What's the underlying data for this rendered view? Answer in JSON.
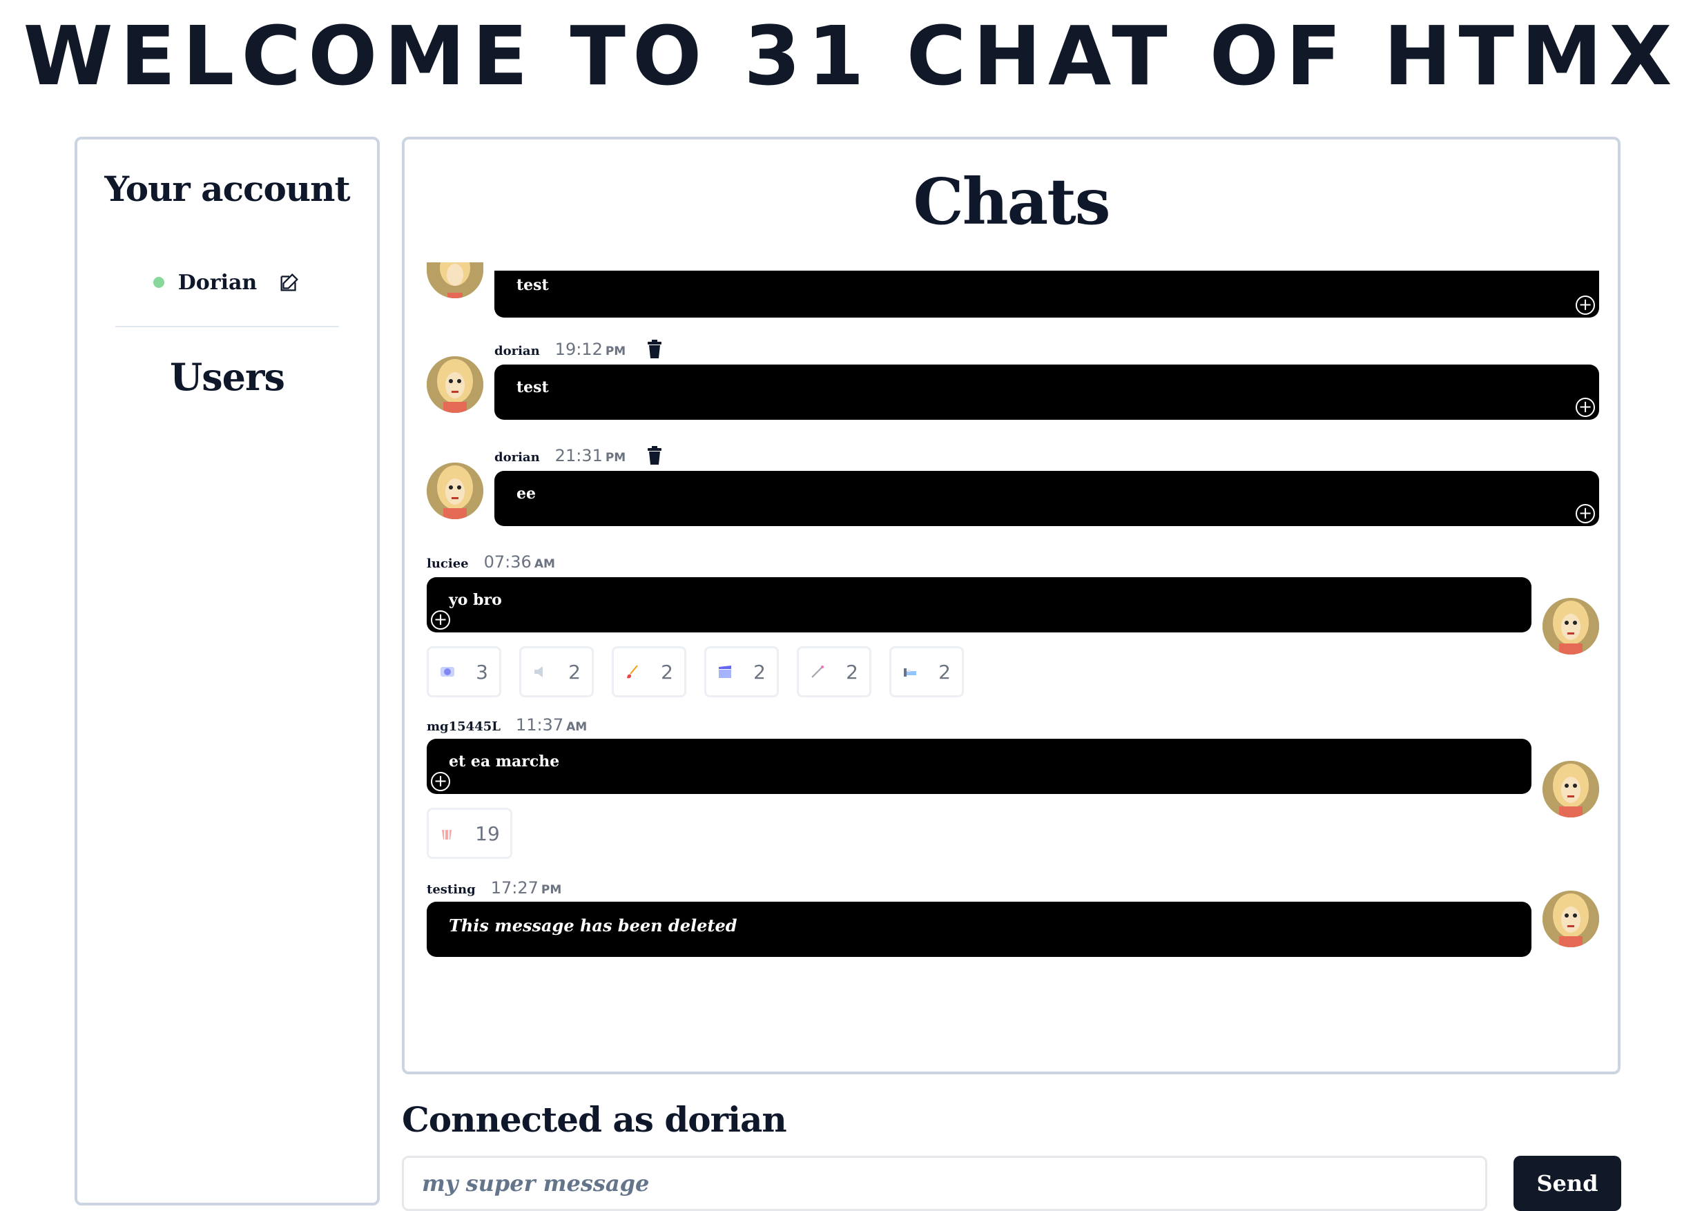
{
  "page_title": "WELCOME TO 31 CHAT OF HTMX",
  "account": {
    "heading": "Your account",
    "username": "Dorian",
    "users_heading": "Users"
  },
  "chats": {
    "heading": "Chats",
    "messages": [
      {
        "text": "test"
      },
      {
        "author": "dorian",
        "time": "19:12",
        "ampm": "PM",
        "text": "test"
      },
      {
        "author": "dorian",
        "time": "21:31",
        "ampm": "PM",
        "text": "ee"
      },
      {
        "author": "luciee",
        "time": "07:36",
        "ampm": "AM",
        "text": "yo bro"
      },
      {
        "author": "mg15445L",
        "time": "11:37",
        "ampm": "AM",
        "text": "et ea marche"
      },
      {
        "author": "testing",
        "time": "17:27",
        "ampm": "PM",
        "text": "This message has been deleted"
      }
    ],
    "reactions_yo_bro": [
      {
        "icon": "blue-circle-icon",
        "count": "3"
      },
      {
        "icon": "speaker-icon",
        "count": "2"
      },
      {
        "icon": "brush-icon",
        "count": "2"
      },
      {
        "icon": "clapper-icon",
        "count": "2"
      },
      {
        "icon": "wand-icon",
        "count": "2"
      },
      {
        "icon": "bed-icon",
        "count": "2"
      }
    ],
    "reactions_et_ea_marche": [
      {
        "icon": "popcorn-icon",
        "count": "19"
      }
    ]
  },
  "composer": {
    "connected_label": "Connected as dorian",
    "placeholder": "my super message",
    "send_label": "Send"
  },
  "colors": {
    "accent": "#111827",
    "bubble": "#000000",
    "online": "#86d99a",
    "border": "#cbd5e1"
  }
}
